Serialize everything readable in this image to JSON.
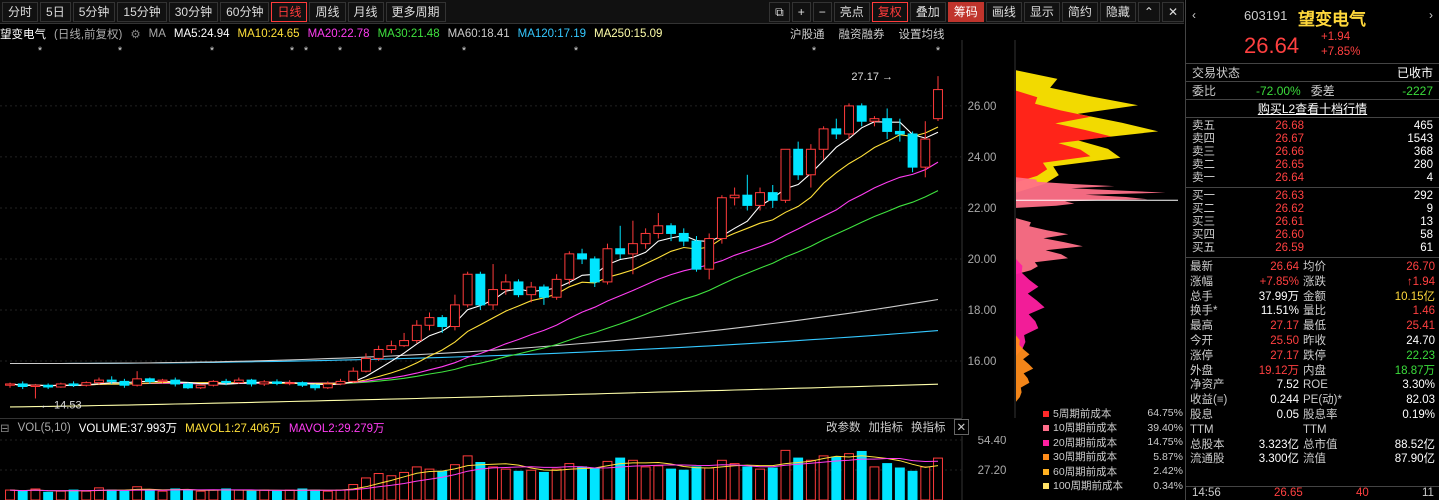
{
  "toolbar": {
    "periods": [
      "分时",
      "5日",
      "5分钟",
      "15分钟",
      "30分钟",
      "60分钟",
      "日线",
      "周线",
      "月线",
      "更多周期"
    ],
    "active_period": "日线",
    "right_buttons": [
      "亮点",
      "复权",
      "叠加",
      "筹码",
      "画线",
      "显示",
      "简约",
      "隐藏"
    ]
  },
  "ma_line": {
    "name": "望变电气",
    "mode": "(日线,前复权)",
    "ma_label": "MA",
    "ma5": "MA5:24.94",
    "ma10": "MA10:24.65",
    "ma20": "MA20:22.78",
    "ma30": "MA30:21.48",
    "ma60": "MA60:18.41",
    "ma120": "MA120:17.19",
    "ma250": "MA250:15.09"
  },
  "top_links": [
    "沪股通",
    "融资融券",
    "设置均线"
  ],
  "chart_labels": {
    "high": "27.17",
    "low": "14.53"
  },
  "y_ticks": [
    "26.00",
    "24.00",
    "22.00",
    "20.00",
    "18.00",
    "16.00"
  ],
  "vol_line": {
    "vol": "VOL(5,10)",
    "volume": "VOLUME:37.993万",
    "mavol1": "MAVOL1:27.406万",
    "mavol2": "MAVOL2:29.279万"
  },
  "vol_tools": [
    "改参数",
    "加指标",
    "换指标"
  ],
  "vol_ticks": [
    "54.40",
    "27.20"
  ],
  "chip_legend": [
    {
      "label": "5周期前成本",
      "value": "64.75%",
      "color": "#ff2a2a"
    },
    {
      "label": "10周期前成本",
      "value": "39.40%",
      "color": "#ff6e8a"
    },
    {
      "label": "20周期前成本",
      "value": "14.75%",
      "color": "#ff1fa0"
    },
    {
      "label": "30周期前成本",
      "value": "5.87%",
      "color": "#ff8c1a"
    },
    {
      "label": "60周期前成本",
      "value": "2.42%",
      "color": "#ffb020"
    },
    {
      "label": "100周期前成本",
      "value": "0.34%",
      "color": "#ffe066"
    }
  ],
  "panel": {
    "code": "603191",
    "name": "望变电气",
    "price": "26.64",
    "change": "+1.94",
    "change_pct": "+7.85%",
    "trade_state_label": "交易状态",
    "trade_state": "已收市",
    "weibi_label": "委比",
    "weibi": "-72.00%",
    "weicha_label": "委差",
    "weicha": "-2227",
    "l2_link": "购买L2查看十档行情",
    "asks": [
      {
        "label": "卖五",
        "price": "26.68",
        "vol": "465"
      },
      {
        "label": "卖四",
        "price": "26.67",
        "vol": "1543"
      },
      {
        "label": "卖三",
        "price": "26.66",
        "vol": "368"
      },
      {
        "label": "卖二",
        "price": "26.65",
        "vol": "280"
      },
      {
        "label": "卖一",
        "price": "26.64",
        "vol": "4"
      }
    ],
    "bids": [
      {
        "label": "买一",
        "price": "26.63",
        "vol": "292"
      },
      {
        "label": "买二",
        "price": "26.62",
        "vol": "9"
      },
      {
        "label": "买三",
        "price": "26.61",
        "vol": "13"
      },
      {
        "label": "买四",
        "price": "26.60",
        "vol": "58"
      },
      {
        "label": "买五",
        "price": "26.59",
        "vol": "61"
      }
    ],
    "stats": [
      [
        "最新",
        "26.64",
        "r",
        "均价",
        "26.70",
        "r"
      ],
      [
        "涨幅",
        "+7.85%",
        "r",
        "涨跌",
        "↑1.94",
        "r"
      ],
      [
        "总手",
        "37.99万",
        "w",
        "金额",
        "10.15亿",
        "y"
      ],
      [
        "换手*",
        "11.51%",
        "w",
        "量比",
        "1.46",
        "r"
      ],
      [
        "最高",
        "27.17",
        "r",
        "最低",
        "25.41",
        "r"
      ],
      [
        "今开",
        "25.50",
        "r",
        "昨收",
        "24.70",
        "w"
      ],
      [
        "涨停",
        "27.17",
        "r",
        "跌停",
        "22.23",
        "g"
      ],
      [
        "外盘",
        "19.12万",
        "r",
        "内盘",
        "18.87万",
        "g"
      ],
      [
        "净资产",
        "7.52",
        "w",
        "ROE",
        "3.30%",
        "w"
      ],
      [
        "收益(≡)",
        "0.244",
        "w",
        "PE(动)*",
        "82.03",
        "w"
      ],
      [
        "股息TTM",
        "0.05",
        "w",
        "股息率TTM",
        "0.19%",
        "w"
      ],
      [
        "总股本",
        "3.323亿",
        "w",
        "总市值",
        "88.52亿",
        "w"
      ],
      [
        "流通股",
        "3.300亿",
        "w",
        "流值",
        "87.90亿",
        "w"
      ]
    ],
    "last_tick": {
      "time": "14:56",
      "price": "26.65",
      "vol": "40",
      "num": "11"
    }
  },
  "chart_data": {
    "type": "candlestick",
    "title": "望变电气 (日线,前复权)",
    "ylim": [
      14.0,
      27.8
    ],
    "candles": [
      [
        15.05,
        15.1,
        14.95,
        15.15
      ],
      [
        15.1,
        15.0,
        14.9,
        15.2
      ],
      [
        15.0,
        15.05,
        14.53,
        15.1
      ],
      [
        15.05,
        14.98,
        14.9,
        15.12
      ],
      [
        14.98,
        15.1,
        14.95,
        15.15
      ],
      [
        15.1,
        15.05,
        14.98,
        15.2
      ],
      [
        15.05,
        15.15,
        15.0,
        15.2
      ],
      [
        15.15,
        15.25,
        15.08,
        15.35
      ],
      [
        15.25,
        15.2,
        15.1,
        15.4
      ],
      [
        15.2,
        15.05,
        14.95,
        15.3
      ],
      [
        15.05,
        15.3,
        15.0,
        15.6
      ],
      [
        15.3,
        15.2,
        15.1,
        15.35
      ],
      [
        15.2,
        15.25,
        15.12,
        15.3
      ],
      [
        15.25,
        15.1,
        15.0,
        15.35
      ],
      [
        15.1,
        14.95,
        14.9,
        15.15
      ],
      [
        14.95,
        15.05,
        14.9,
        15.1
      ],
      [
        15.05,
        15.2,
        15.0,
        15.25
      ],
      [
        15.2,
        15.15,
        15.05,
        15.3
      ],
      [
        15.15,
        15.25,
        15.1,
        15.35
      ],
      [
        15.25,
        15.1,
        15.0,
        15.3
      ],
      [
        15.1,
        15.18,
        15.02,
        15.25
      ],
      [
        15.18,
        15.12,
        15.05,
        15.28
      ],
      [
        15.12,
        15.15,
        15.05,
        15.25
      ],
      [
        15.15,
        15.05,
        14.98,
        15.2
      ],
      [
        15.05,
        14.95,
        14.85,
        15.1
      ],
      [
        14.95,
        15.1,
        14.9,
        15.2
      ],
      [
        15.1,
        15.2,
        15.05,
        15.3
      ],
      [
        15.2,
        15.6,
        15.15,
        15.75
      ],
      [
        15.6,
        16.1,
        15.55,
        16.3
      ],
      [
        16.1,
        16.45,
        16.0,
        16.6
      ],
      [
        16.45,
        16.6,
        16.3,
        16.8
      ],
      [
        16.6,
        16.8,
        16.55,
        17.1
      ],
      [
        16.8,
        17.4,
        16.7,
        17.6
      ],
      [
        17.4,
        17.7,
        17.2,
        17.9
      ],
      [
        17.7,
        17.35,
        17.1,
        17.8
      ],
      [
        17.35,
        18.2,
        17.2,
        18.6
      ],
      [
        18.2,
        19.4,
        18.1,
        19.5
      ],
      [
        19.4,
        18.2,
        18.0,
        19.5
      ],
      [
        18.2,
        18.8,
        18.0,
        19.8
      ],
      [
        18.8,
        19.1,
        18.6,
        19.4
      ],
      [
        19.1,
        18.6,
        18.5,
        19.2
      ],
      [
        18.6,
        18.9,
        18.3,
        19.1
      ],
      [
        18.9,
        18.5,
        18.2,
        19.0
      ],
      [
        18.5,
        19.2,
        18.4,
        19.4
      ],
      [
        19.2,
        20.2,
        19.0,
        20.3
      ],
      [
        20.2,
        20.0,
        19.8,
        20.4
      ],
      [
        20.0,
        19.1,
        18.9,
        20.1
      ],
      [
        19.1,
        20.4,
        19.0,
        20.6
      ],
      [
        20.4,
        20.2,
        20.0,
        21.3
      ],
      [
        20.2,
        20.6,
        19.4,
        21.5
      ],
      [
        20.6,
        21.0,
        20.4,
        21.2
      ],
      [
        21.0,
        21.3,
        20.8,
        21.8
      ],
      [
        21.3,
        21.0,
        20.7,
        21.4
      ],
      [
        21.0,
        20.7,
        20.5,
        21.2
      ],
      [
        20.7,
        19.6,
        19.5,
        20.9
      ],
      [
        19.6,
        20.8,
        19.2,
        21.0
      ],
      [
        20.8,
        22.4,
        20.6,
        22.5
      ],
      [
        22.4,
        22.5,
        22.1,
        22.8
      ],
      [
        22.5,
        22.1,
        21.9,
        23.3
      ],
      [
        22.1,
        22.6,
        21.9,
        22.8
      ],
      [
        22.6,
        22.3,
        22.0,
        22.9
      ],
      [
        22.3,
        24.3,
        22.2,
        24.3
      ],
      [
        24.3,
        23.3,
        23.1,
        24.6
      ],
      [
        23.3,
        24.3,
        22.8,
        24.5
      ],
      [
        24.3,
        25.1,
        23.9,
        25.2
      ],
      [
        25.1,
        24.9,
        24.7,
        25.5
      ],
      [
        24.9,
        26.0,
        24.7,
        26.1
      ],
      [
        26.0,
        25.4,
        25.2,
        26.1
      ],
      [
        25.4,
        25.5,
        25.2,
        25.6
      ],
      [
        25.5,
        25.0,
        24.7,
        25.9
      ],
      [
        25.0,
        24.9,
        24.6,
        25.5
      ],
      [
        24.9,
        23.6,
        23.4,
        25.0
      ],
      [
        23.6,
        24.7,
        23.2,
        25.4
      ],
      [
        25.5,
        26.64,
        25.41,
        27.17
      ]
    ],
    "volumes": [
      9,
      8,
      10,
      7,
      8,
      9,
      8,
      11,
      9,
      8,
      12,
      9,
      8,
      10,
      9,
      8,
      9,
      10,
      9,
      8,
      9,
      8,
      9,
      10,
      9,
      8,
      9,
      14,
      20,
      24,
      22,
      25,
      30,
      28,
      26,
      32,
      40,
      34,
      30,
      28,
      26,
      27,
      25,
      28,
      33,
      30,
      29,
      35,
      38,
      36,
      30,
      31,
      28,
      27,
      30,
      29,
      36,
      33,
      30,
      28,
      29,
      45,
      38,
      36,
      40,
      39,
      42,
      44,
      30,
      33,
      29,
      26,
      30,
      38
    ]
  }
}
